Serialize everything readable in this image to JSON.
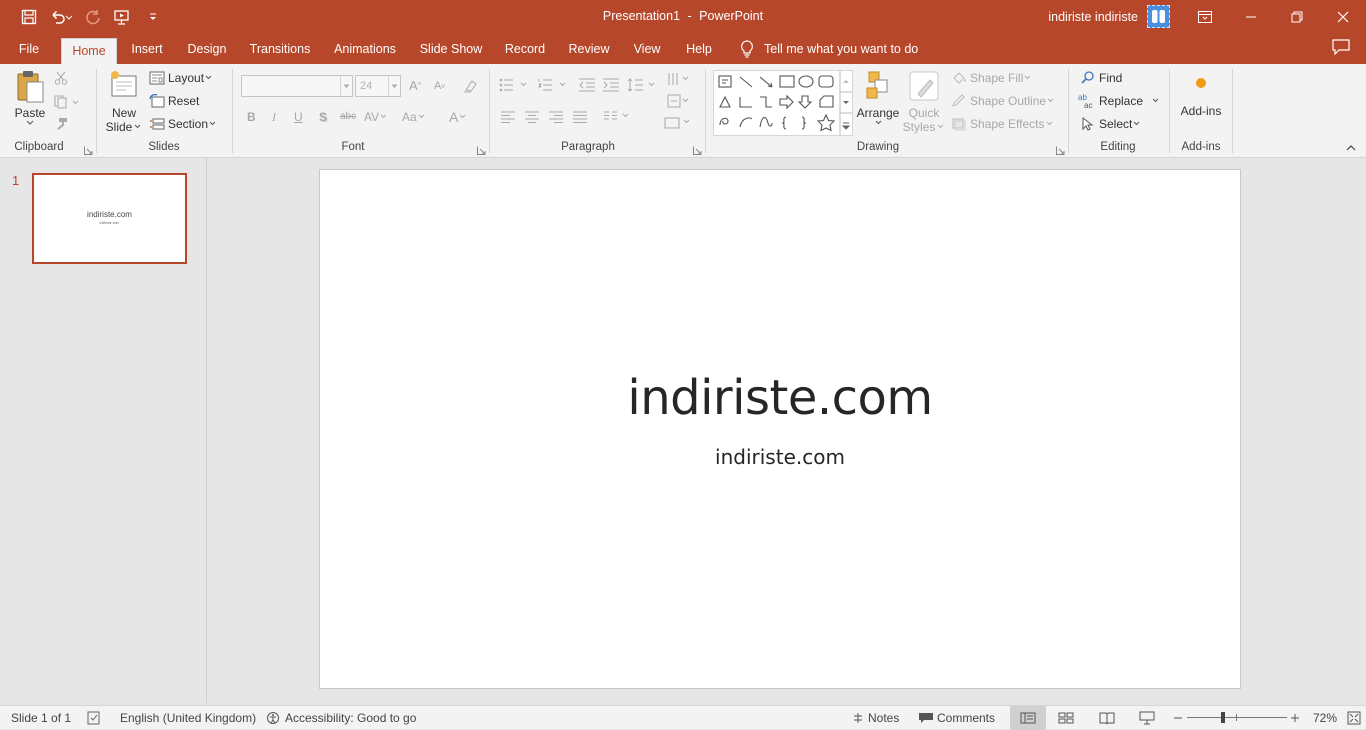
{
  "window": {
    "doc_name": "Presentation1",
    "separator": "-",
    "app_name": "PowerPoint",
    "user_name": "indiriste indiriste"
  },
  "colors": {
    "accent": "#b7472a",
    "ribbon_bg": "#f3f3f3",
    "workspace_bg": "#e6e6e6"
  },
  "tabs": [
    "File",
    "Home",
    "Insert",
    "Design",
    "Transitions",
    "Animations",
    "Slide Show",
    "Record",
    "Review",
    "View",
    "Help"
  ],
  "active_tab": "Home",
  "tell_me": "Tell me what you want to do",
  "ribbon": {
    "clipboard": {
      "label": "Clipboard",
      "paste": "Paste"
    },
    "slides": {
      "label": "Slides",
      "new_slide_1": "New",
      "new_slide_2": "Slide",
      "layout": "Layout",
      "reset": "Reset",
      "section": "Section"
    },
    "font": {
      "label": "Font",
      "font_name": "",
      "font_size": "24",
      "bold": "B",
      "italic": "I",
      "underline": "U",
      "shadow": "S",
      "strike": "abc",
      "spacing": "AV",
      "case": "Aa",
      "color": "A",
      "grow": "A",
      "shrink": "A"
    },
    "paragraph": {
      "label": "Paragraph"
    },
    "drawing": {
      "label": "Drawing",
      "arrange": "Arrange",
      "quick_1": "Quick",
      "quick_2": "Styles",
      "shape_fill": "Shape Fill",
      "shape_outline": "Shape Outline",
      "shape_effects": "Shape Effects"
    },
    "editing": {
      "label": "Editing",
      "find": "Find",
      "replace": "Replace",
      "select": "Select"
    },
    "addins": {
      "label": "Add-ins",
      "button": "Add-ins"
    }
  },
  "slides": [
    {
      "number": "1",
      "title": "indiriste.com",
      "subtitle": "indiriste.com"
    }
  ],
  "current_slide": {
    "title": "indiriste.com",
    "subtitle": "indiriste.com"
  },
  "status": {
    "slide_info": "Slide 1 of 1",
    "language": "English (United Kingdom)",
    "accessibility": "Accessibility: Good to go",
    "notes": "Notes",
    "comments": "Comments",
    "zoom": "72%",
    "zoom_level_fraction": 0.5
  }
}
